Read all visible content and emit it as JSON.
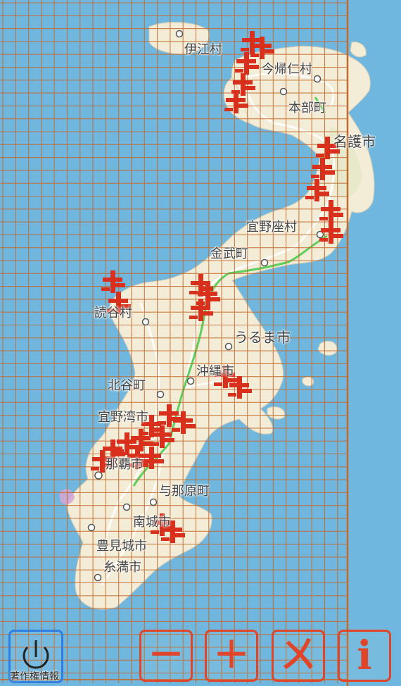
{
  "map": {
    "place_labels": [
      {
        "key": "iejima",
        "text": "伊江村"
      },
      {
        "key": "nakijin",
        "text": "今帰仁村"
      },
      {
        "key": "motobu",
        "text": "本部町"
      },
      {
        "key": "nago",
        "text": "名護市"
      },
      {
        "key": "ginoza",
        "text": "宜野座村"
      },
      {
        "key": "kin",
        "text": "金武町"
      },
      {
        "key": "yomitan",
        "text": "読谷村"
      },
      {
        "key": "uruma",
        "text": "うるま市"
      },
      {
        "key": "okinawa",
        "text": "沖縄市"
      },
      {
        "key": "chatan",
        "text": "北谷町"
      },
      {
        "key": "ginowan",
        "text": "宜野湾市"
      },
      {
        "key": "naha",
        "text": "那覇市"
      },
      {
        "key": "yonabaru",
        "text": "与那原町"
      },
      {
        "key": "nanjo",
        "text": "南城市"
      },
      {
        "key": "tomigusuku",
        "text": "豊見城市"
      },
      {
        "key": "itoman",
        "text": "糸満市"
      }
    ],
    "colors": {
      "sea": "#6fb7de",
      "land": "#f3ecd6",
      "grid": "#c46a2c",
      "route": "#5ccf5c",
      "marker": "#d8301c"
    },
    "grid_visible": true
  },
  "controls": {
    "power_icon": "power-icon",
    "copyright_label": "著作権情報",
    "zoom_out_icon": "minus-icon",
    "zoom_out_glyph": "－",
    "zoom_in_icon": "plus-icon",
    "zoom_in_glyph": "＋",
    "clear_icon": "clear-icon",
    "clear_glyph": "ㄨ",
    "info_icon": "info-icon",
    "info_glyph": "i"
  }
}
